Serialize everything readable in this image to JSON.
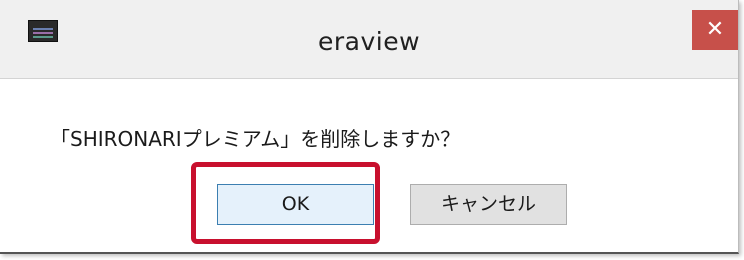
{
  "window": {
    "title": "eraview",
    "close_glyph": "✕"
  },
  "dialog": {
    "message": "「SHIRONARIプレミアム」を削除しますか？",
    "ok_label": "OK",
    "cancel_label": "キャンセル"
  },
  "icons": {
    "app": "app-icon",
    "close": "close-icon"
  },
  "colors": {
    "close_button_bg": "#c7504a",
    "highlight_border": "#c8102e",
    "ok_button_border": "#3c7fb1",
    "dialog_bg": "#f0f0f0"
  }
}
